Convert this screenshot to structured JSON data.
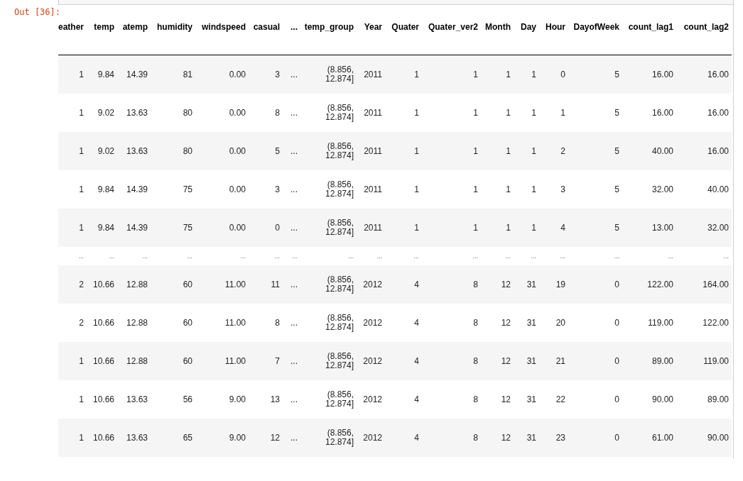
{
  "prompt": "Out [36]:",
  "table": {
    "columns": [
      "eather",
      "temp",
      "atemp",
      "humidity",
      "windspeed",
      "casual",
      "...",
      "temp_group",
      "Year",
      "Quater",
      "Quater_ver2",
      "Month",
      "Day",
      "Hour",
      "DayofWeek",
      "count_lag1",
      "count_lag2"
    ],
    "rows": [
      {
        "kind": "data",
        "cells": [
          "1",
          "9.84",
          "14.39",
          "81",
          "0.00",
          "3",
          "...",
          "(8.856, 12.874]",
          "2011",
          "1",
          "1",
          "1",
          "1",
          "0",
          "5",
          "16.00",
          "16.00"
        ]
      },
      {
        "kind": "data",
        "cells": [
          "1",
          "9.02",
          "13.63",
          "80",
          "0.00",
          "8",
          "...",
          "(8.856, 12.874]",
          "2011",
          "1",
          "1",
          "1",
          "1",
          "1",
          "5",
          "16.00",
          "16.00"
        ]
      },
      {
        "kind": "data",
        "cells": [
          "1",
          "9.02",
          "13.63",
          "80",
          "0.00",
          "5",
          "...",
          "(8.856, 12.874]",
          "2011",
          "1",
          "1",
          "1",
          "1",
          "2",
          "5",
          "40.00",
          "16.00"
        ]
      },
      {
        "kind": "data",
        "cells": [
          "1",
          "9.84",
          "14.39",
          "75",
          "0.00",
          "3",
          "...",
          "(8.856, 12.874]",
          "2011",
          "1",
          "1",
          "1",
          "1",
          "3",
          "5",
          "32.00",
          "40.00"
        ]
      },
      {
        "kind": "data",
        "cells": [
          "1",
          "9.84",
          "14.39",
          "75",
          "0.00",
          "0",
          "...",
          "(8.856, 12.874]",
          "2011",
          "1",
          "1",
          "1",
          "1",
          "4",
          "5",
          "13.00",
          "32.00"
        ]
      },
      {
        "kind": "ellipsis",
        "cells": [
          "...",
          "...",
          "...",
          "...",
          "...",
          "...",
          "...",
          "...",
          "...",
          "...",
          "...",
          "...",
          "...",
          "...",
          "...",
          "...",
          "..."
        ]
      },
      {
        "kind": "data",
        "cells": [
          "2",
          "10.66",
          "12.88",
          "60",
          "11.00",
          "11",
          "...",
          "(8.856, 12.874]",
          "2012",
          "4",
          "8",
          "12",
          "31",
          "19",
          "0",
          "122.00",
          "164.00"
        ]
      },
      {
        "kind": "data",
        "cells": [
          "2",
          "10.66",
          "12.88",
          "60",
          "11.00",
          "8",
          "...",
          "(8.856, 12.874]",
          "2012",
          "4",
          "8",
          "12",
          "31",
          "20",
          "0",
          "119.00",
          "122.00"
        ]
      },
      {
        "kind": "data",
        "cells": [
          "1",
          "10.66",
          "12.88",
          "60",
          "11.00",
          "7",
          "...",
          "(8.856, 12.874]",
          "2012",
          "4",
          "8",
          "12",
          "31",
          "21",
          "0",
          "89.00",
          "119.00"
        ]
      },
      {
        "kind": "data",
        "cells": [
          "1",
          "10.66",
          "13.63",
          "56",
          "9.00",
          "13",
          "...",
          "(8.856, 12.874]",
          "2012",
          "4",
          "8",
          "12",
          "31",
          "22",
          "0",
          "90.00",
          "89.00"
        ]
      },
      {
        "kind": "data",
        "cells": [
          "1",
          "10.66",
          "13.63",
          "65",
          "9.00",
          "12",
          "...",
          "(8.856, 12.874]",
          "2012",
          "4",
          "8",
          "12",
          "31",
          "23",
          "0",
          "61.00",
          "90.00"
        ]
      }
    ]
  }
}
